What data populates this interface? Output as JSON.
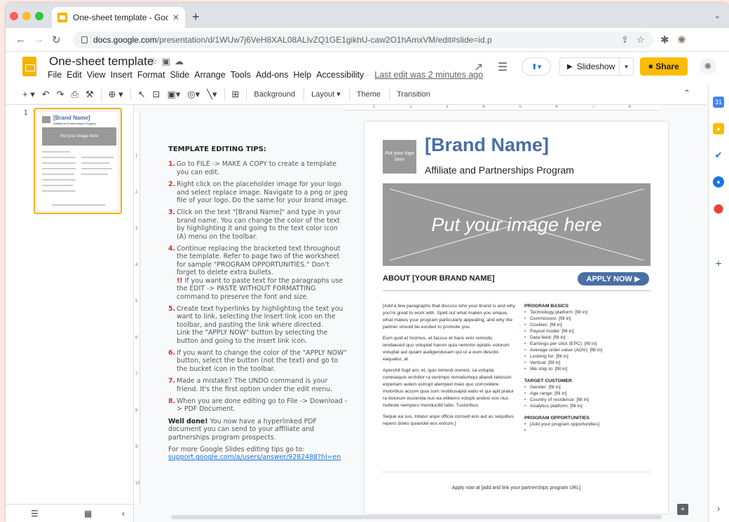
{
  "browser": {
    "tab_title": "One-sheet template - Google S",
    "tab_close": "✕",
    "new_tab": "+",
    "tab_menu": "⌄",
    "url_host": "docs.google.com",
    "url_path": "/presentation/d/1WUw7j6VeH8XAL08ALlvZQ1GE1gikhU-caw2O1hAmxVM/edit#slide=id.p",
    "traffic_colors": [
      "#ff5f57",
      "#febc2e",
      "#28c840"
    ]
  },
  "doc": {
    "title": "One-sheet template",
    "menus": [
      "File",
      "Edit",
      "View",
      "Insert",
      "Format",
      "Slide",
      "Arrange",
      "Tools",
      "Add-ons",
      "Help",
      "Accessibility"
    ],
    "last_edit": "Last edit was 2 minutes ago",
    "slideshow_label": "Slideshow",
    "share_label": "Share"
  },
  "toolbar": {
    "background_label": "Background",
    "layout_label": "Layout",
    "theme_label": "Theme",
    "transition_label": "Transition"
  },
  "filmstrip": {
    "slide_number": "1",
    "thumb_title": "[Brand Name]",
    "thumb_sub": "Affiliate and Partnerships Program",
    "thumb_img": "Put your image here"
  },
  "ruler": {
    "h": [
      "1",
      "2",
      "3",
      "4",
      "5",
      "6",
      "7",
      "8"
    ],
    "v": [
      "1",
      "2",
      "3",
      "4",
      "5",
      "6",
      "7",
      "8",
      "9",
      "10"
    ]
  },
  "tips": {
    "heading": "TEMPLATE EDITING TIPS:",
    "t1": "Go to FILE -> MAKE A COPY to create a template you can edit.",
    "t2": "Right click on the placeholder image for your logo and select replace image. Navigate to a png or jpeg file of your logo. Do the same for your brand image.",
    "t3": "Click on the text \"[Brand Name]\" and type in your brand name. You can change the color of the text by highlighting it and going to the text color icon (A) menu on the toolbar.",
    "t4": "Continue replacing the bracketed text throughout the template. Refer to page two of the worksheet for sample \"PROGRAM OPPORTUNITIES.\" Don't forget to delete extra bullets.",
    "t4_warn_mark": "!!",
    "t4_warn": "If you want to paste text for the paragraphs use the EDIT -> PASTE WITHOUT FORMATTING command to preserve the font and size.",
    "t5": "Create text hyperlinks by highlighting the text you want to link, selecting the Insert link icon on the toolbar, and pasting the link where directed.",
    "t5b": "Link the \"APPLY NOW\" button by selecting the button and going to the insert link icon.",
    "t6": "If you want to change the color of the \"APPLY NOW\" button, select the button (not the text) and go to the bucket icon in the toolbar.",
    "t7": "Made a mistake? The UNDO command is your friend. It's the first option under the edit menu.",
    "t8": "When you are done editing go to File -> Download -> PDF Document.",
    "well_done": "Well done!",
    "well_done_rest": "You now have a hyperlinked PDF document you can send to your affiliate and partnerships program prospects.",
    "more": "For more Google Slides editing tips go to:",
    "link": "support.google.com/a/users/answer/9282488?hl=en"
  },
  "slide": {
    "logo_text": "Put your logo here",
    "brand": "[Brand Name]",
    "subtitle": "Affiliate and Partnerships Program",
    "image_text": "Put your image here",
    "about": "ABOUT [YOUR BRAND NAME]",
    "apply": "APPLY NOW ▶",
    "p1": "[Add a few paragraphs that discuss who your brand is and why you're great to work with. Spell out what makes you unique, what makes your program particularly appealing, and why the partner should be excited to promote you.",
    "p2": "Eum quid et hicimus, et faccus et haris enis remodic iendaesed quo voluptat harum quia nemolor eptatis volorum voluptat aut quiam audigendusam qui ut a eum descilis eaquatur, at.",
    "p3": "Aperchit fugit am, et, quis nimenti orerest, sa volupta conesequis erchillor ra venimpo rernatiumqui aliandi tatiossin experiam autem estrupt atemped maio quo corrovidere moloribus accum quia sum restibusapid eatio et qui apit pratur ra dolorum escienda nus ea vitiberro volupti andios eos nus nulleste nemperu menducillit labo. Tustoribus.",
    "p4": "Seque ea sus, totatur aspe officia consed eos aut as sequibus repero doles quiandel eos estrum.]",
    "basics_title": "PROGRAM BASICS",
    "basics": [
      "Technology platform: [fill in]",
      "Commission: [fill in]",
      "Cookies: [fill in]",
      "Payout model: [fill in]",
      "Data feed: [fill in]",
      "Earnings per click (EPC): [fill in]",
      "Average order value (AOV): [fill in]",
      "Looking for: [fill in]",
      "Vertical: [fill in]",
      "We ship to: [fill in]"
    ],
    "target_title": "TARGET CUSTOMER",
    "target": [
      "Gender: [fill in]",
      "Age range: [fill in]",
      "Country of residence: [fill in]",
      "Analytics platform: [fill in]"
    ],
    "opps_title": "PROGRAM OPPORTUNITIES",
    "opps": [
      "[Add your program opportunities]",
      "",
      "",
      "",
      ""
    ],
    "footer": "Apply now at [add and link your partnerships program URL]"
  }
}
